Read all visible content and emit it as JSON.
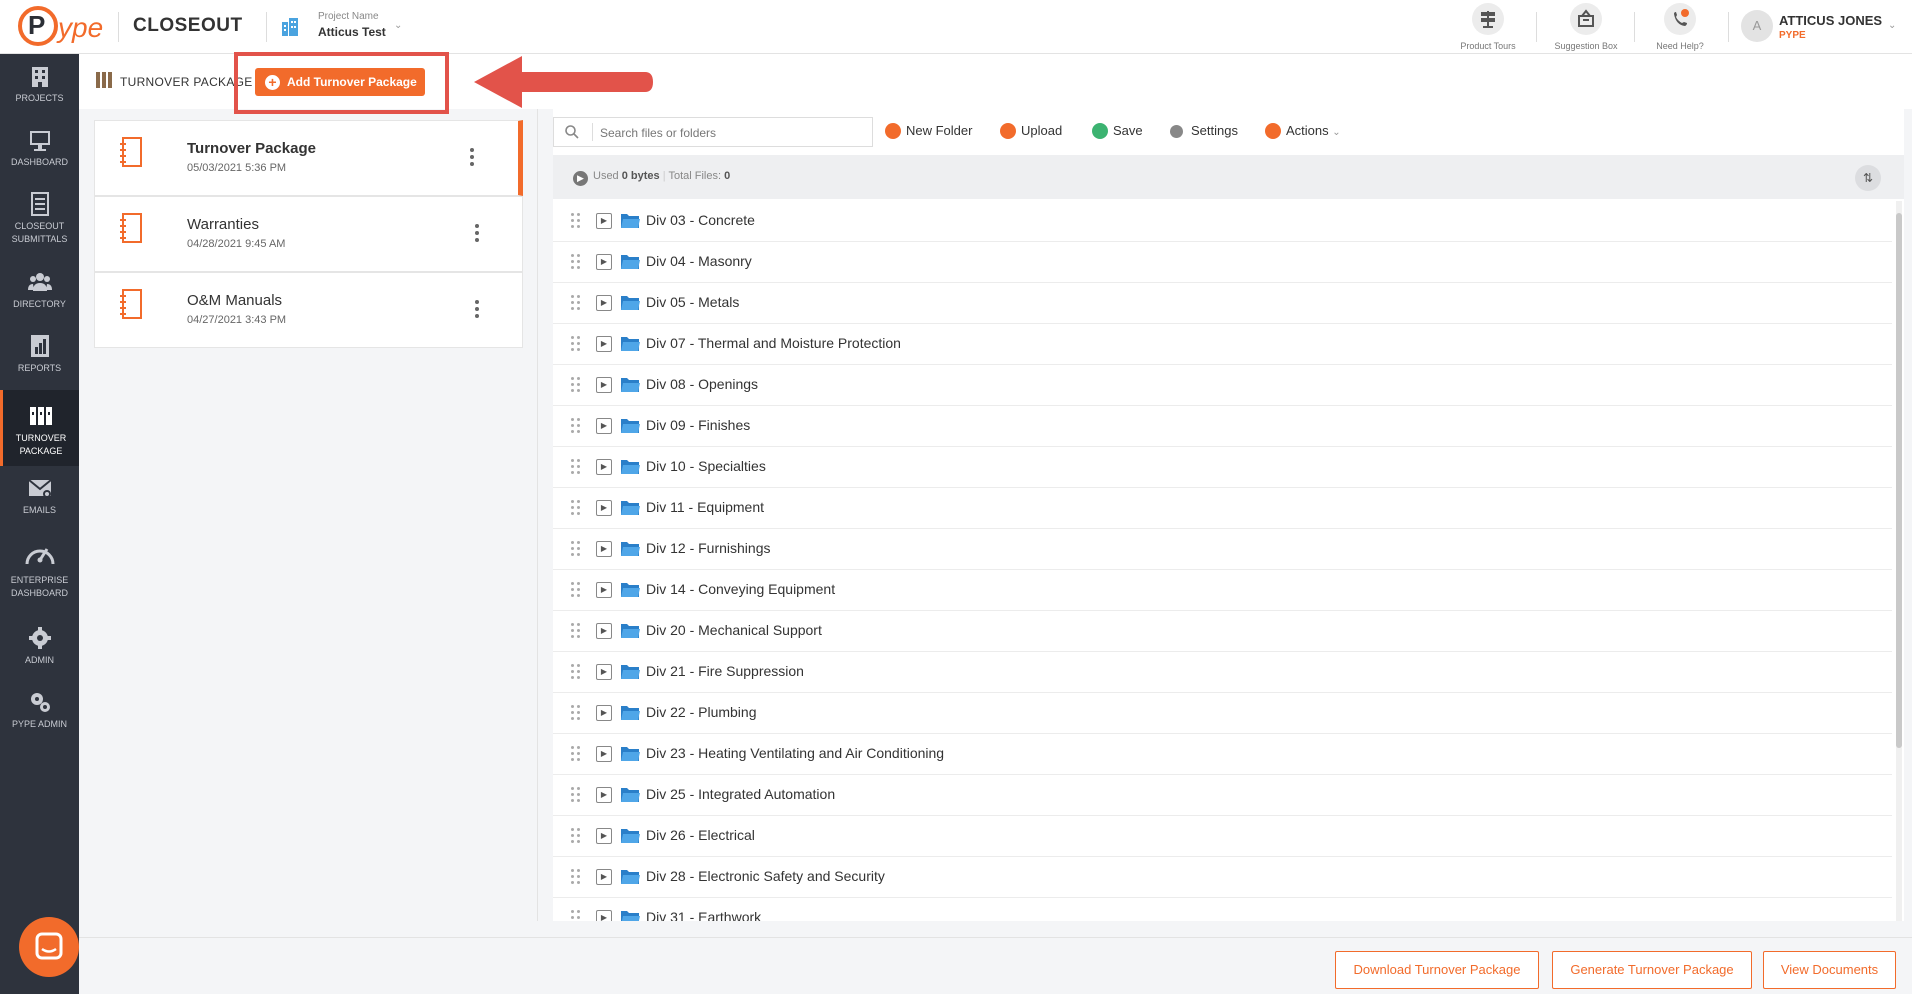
{
  "header": {
    "app_title": "CLOSEOUT",
    "project_label": "Project Name",
    "project_name": "Atticus Test",
    "tools": [
      {
        "label": "Product Tours",
        "icon": "signpost-icon"
      },
      {
        "label": "Suggestion Box",
        "icon": "suggestion-box-icon"
      },
      {
        "label": "Need Help?",
        "icon": "help-phone-icon"
      }
    ],
    "user_initial": "A",
    "user_name": "ATTICUS JONES",
    "user_org": "PYPE"
  },
  "sidebar": {
    "items": [
      {
        "label": "PROJECTS",
        "icon": "building-icon",
        "active": false
      },
      {
        "label": "DASHBOARD",
        "icon": "monitor-icon",
        "active": false
      },
      {
        "label": "CLOSEOUT SUBMITTALS",
        "icon": "document-list-icon",
        "active": false
      },
      {
        "label": "DIRECTORY",
        "icon": "people-icon",
        "active": false
      },
      {
        "label": "REPORTS",
        "icon": "report-chart-icon",
        "active": false
      },
      {
        "label": "TURNOVER PACKAGE",
        "icon": "binders-icon",
        "active": true
      },
      {
        "label": "EMAILS",
        "icon": "envelope-icon",
        "active": false
      },
      {
        "label": "ENTERPRISE DASHBOARD",
        "icon": "speedometer-icon",
        "active": false
      },
      {
        "label": "ADMIN",
        "icon": "gear-icon",
        "active": false
      },
      {
        "label": "PYPE ADMIN",
        "icon": "gears-icon",
        "active": false
      }
    ]
  },
  "page": {
    "title": "TURNOVER PACKAGE",
    "add_button": "Add Turnover Package"
  },
  "packages": [
    {
      "name": "Turnover Package",
      "date": "05/03/2021 5:36 PM",
      "active": true
    },
    {
      "name": "Warranties",
      "date": "04/28/2021 9:45 AM",
      "active": false
    },
    {
      "name": "O&M Manuals",
      "date": "04/27/2021 3:43 PM",
      "active": false
    }
  ],
  "file_browser": {
    "search_placeholder": "Search files or folders",
    "toolbar": {
      "new_folder": "New Folder",
      "upload": "Upload",
      "save": "Save",
      "settings": "Settings",
      "actions": "Actions"
    },
    "stats": {
      "used_label": "Used",
      "used_value": "0 bytes",
      "total_label": "Total Files:",
      "total_value": "0"
    },
    "folders": [
      "Div 03 - Concrete",
      "Div 04 - Masonry",
      "Div 05 - Metals",
      "Div 07 - Thermal and Moisture Protection",
      "Div 08 - Openings",
      "Div 09 - Finishes",
      "Div 10 - Specialties",
      "Div 11 - Equipment",
      "Div 12 - Furnishings",
      "Div 14 - Conveying Equipment",
      "Div 20 - Mechanical Support",
      "Div 21 - Fire Suppression",
      "Div 22 - Plumbing",
      "Div 23 - Heating Ventilating and Air Conditioning",
      "Div 25 - Integrated Automation",
      "Div 26 - Electrical",
      "Div 28 - Electronic Safety and Security",
      "Div 31 - Earthwork"
    ]
  },
  "footer": {
    "download": "Download Turnover Package",
    "generate": "Generate Turnover Package",
    "view": "View Documents"
  },
  "colors": {
    "accent": "#f26b2b",
    "sidebar": "#2e333d",
    "highlight": "#e2534a"
  }
}
